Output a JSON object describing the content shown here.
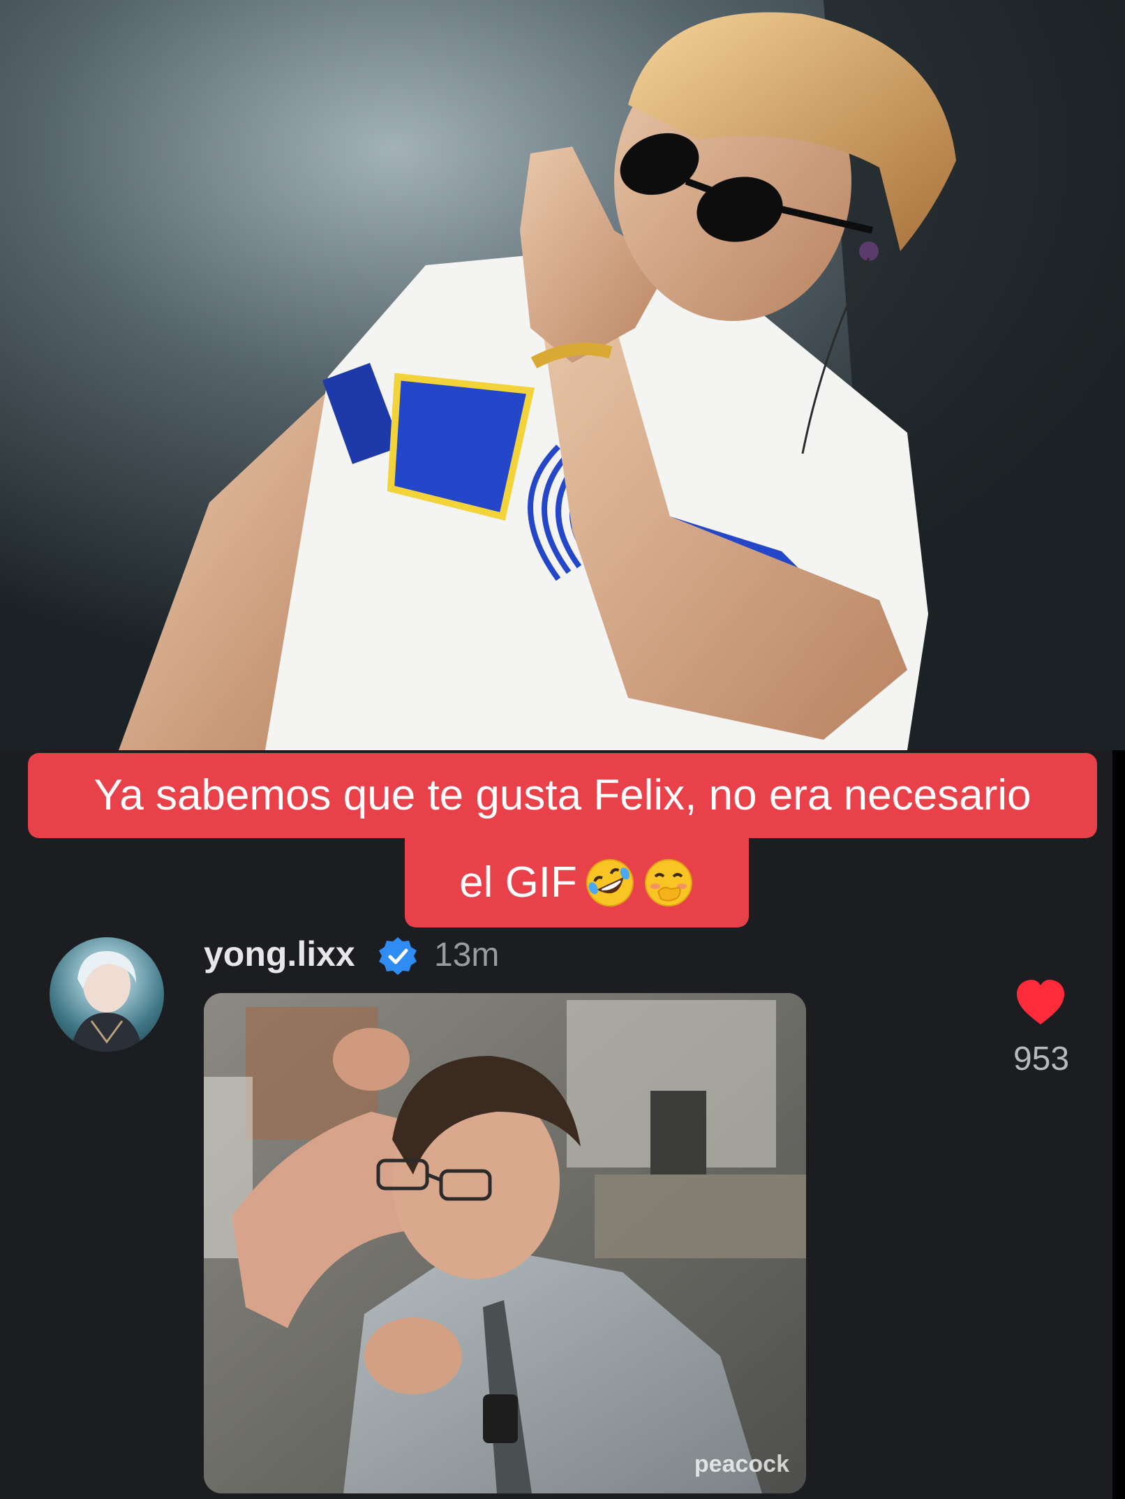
{
  "caption": {
    "line1": "Ya sabemos que te gusta Felix, no era necesario",
    "line2": "el GIF",
    "emojis": [
      "rolling-on-floor-laughing-emoji",
      "face-with-hand-over-mouth-emoji"
    ],
    "background_color": "#e8414a",
    "text_color": "#ffffff"
  },
  "comment": {
    "username": "yong.lixx",
    "verified": true,
    "timestamp": "13m",
    "gif_watermark": "peacock",
    "like_count": "953",
    "like_color": "#ff2b3a",
    "verified_color": "#2f8cf2"
  },
  "theme": {
    "background": "#1c1d20"
  }
}
